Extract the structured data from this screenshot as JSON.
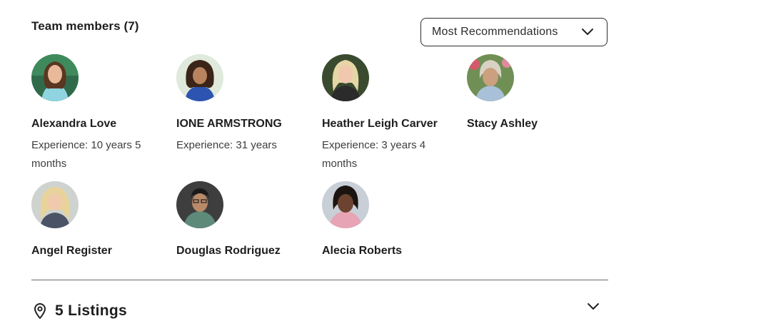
{
  "team": {
    "title": "Team members (7)",
    "sort": {
      "selected": "Most Recommendations",
      "icon": "chevron-down-icon"
    },
    "members": [
      {
        "name": "Alexandra Love",
        "experience": "Experience: 10 years 5 months"
      },
      {
        "name": "IONE ARMSTRONG",
        "experience": "Experience: 31 years"
      },
      {
        "name": "Heather Leigh Carver",
        "experience": "Experience: 3 years 4 months"
      },
      {
        "name": "Stacy Ashley",
        "experience": ""
      },
      {
        "name": "Angel Register",
        "experience": ""
      },
      {
        "name": "Douglas Rodriguez",
        "experience": ""
      },
      {
        "name": "Alecia Roberts",
        "experience": ""
      }
    ]
  },
  "listings": {
    "label": "5 Listings",
    "icon": "location-pin-icon",
    "toggle_icon": "chevron-down-icon"
  }
}
